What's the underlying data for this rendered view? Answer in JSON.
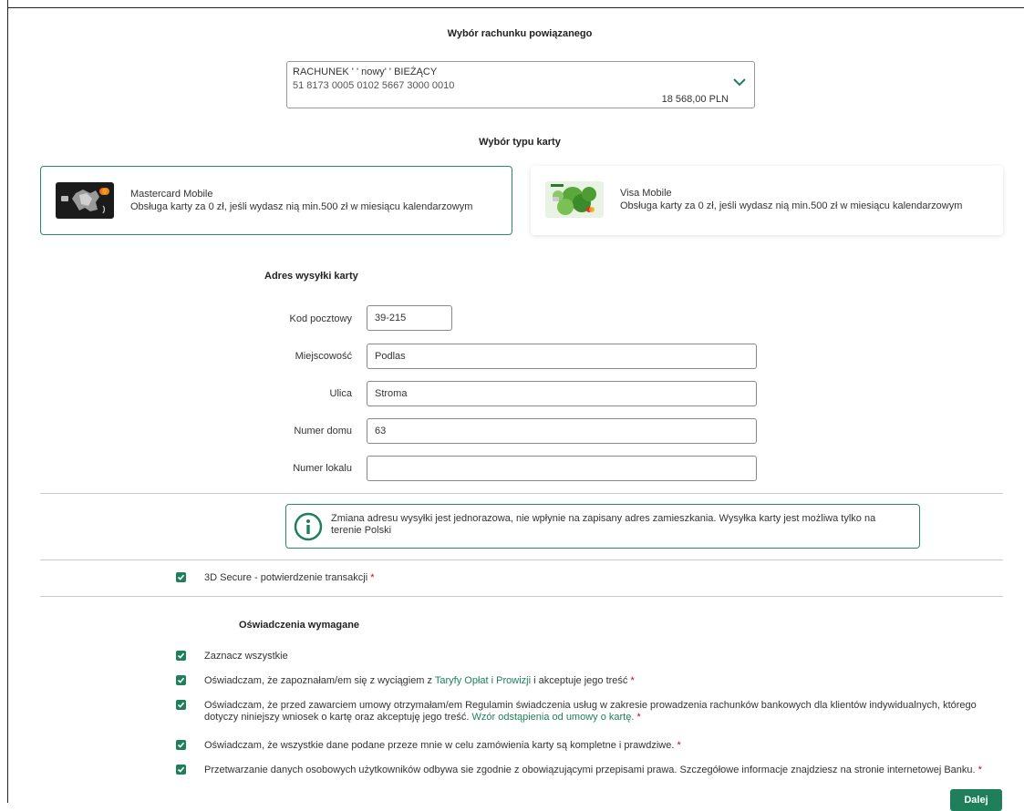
{
  "account_section": {
    "title": "Wybór rachunku powiązanego",
    "name": "RACHUNEK ' ' nowy' ' BIEŻĄCY",
    "number": "51 8173 0005 0102 5667 3000 0010",
    "balance": "18 568,00 PLN"
  },
  "card_type_section": {
    "title": "Wybór typu karty",
    "cards": [
      {
        "name": "Mastercard Mobile",
        "description": "Obsługa karty za 0 zł, jeśli wydasz nią min.500 zł w miesiącu kalendarzowym",
        "selected": true
      },
      {
        "name": "Visa Mobile",
        "description": "Obsługa karty za 0 zł, jeśli wydasz nią min.500 zł w miesiącu kalendarzowym",
        "selected": false
      }
    ]
  },
  "address": {
    "title": "Adres wysyłki karty",
    "fields": [
      {
        "label": "Kod pocztowy",
        "value": "39-215"
      },
      {
        "label": "Miejscowość",
        "value": "Podlas"
      },
      {
        "label": "Ulica",
        "value": "Stroma"
      },
      {
        "label": "Numer domu",
        "value": "63"
      },
      {
        "label": "Numer lokalu",
        "value": ""
      }
    ]
  },
  "info_box": {
    "text": "Zmiana adresu wysyłki jest jednorazowa, nie wpłynie na zapisany adres zamieszkania. Wysyłka karty jest możliwa tylko na terenie Polski"
  },
  "secure": {
    "label": "3D Secure - potwierdzenie transakcji",
    "required_mark": "*"
  },
  "declarations": {
    "title": "Oświadczenia wymagane",
    "select_all": "Zaznacz wszystkie",
    "d1_pre": "Oświadczam, że zapoznałam/em się z wyciągiem z ",
    "d1_link": "Taryfy Opłat i Prowizji",
    "d1_post": " i akceptuje jego treść ",
    "d2_pre": "Oświadczam, że przed zawarciem umowy otrzymałam/em Regulamin świadczenia usług w zakresie prowadzenia rachunków bankowych dla klientów indywidualnych, którego dotyczy niniejszy wniosek o kartę oraz akceptuję jego treść. ",
    "d2_link": "Wzór odstąpienia od umowy o kartę.",
    "d3": "Oświadczam, że wszystkie dane podane przeze mnie w celu zamówienia karty są kompletne i prawdziwe. ",
    "d4": "Przetwarzanie danych osobowych użytkowników odbywa sie zgodnie z obowiązującymi przepisami prawa. Szczegółowe informacje znajdziesz na stronie internetowej Banku. ",
    "required_mark": "*"
  },
  "next_button": "Dalej",
  "colors": {
    "accent": "#1f7f5a",
    "required": "#d0021b"
  }
}
